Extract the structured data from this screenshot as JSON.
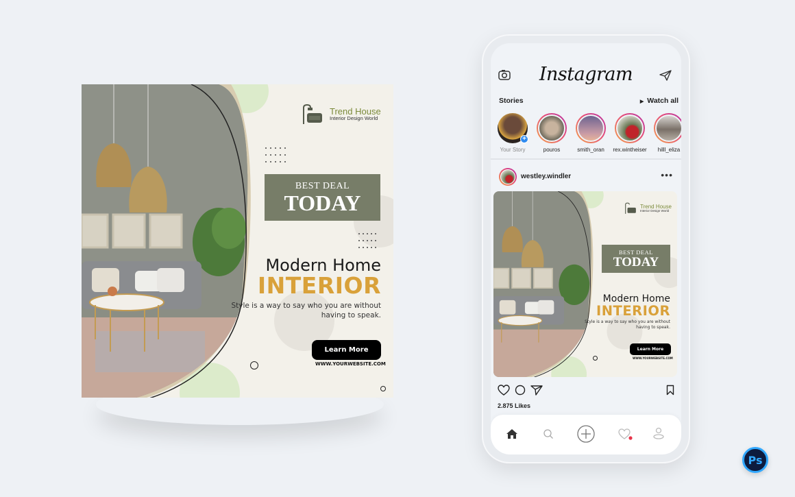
{
  "ad": {
    "brand_name": "Trend House",
    "brand_tagline": "Interior Design World",
    "deal_small": "BEST DEAL",
    "deal_large": "TODAY",
    "headline_line1": "Modern Home",
    "headline_line2": "INTERIOR",
    "description_line1": "Style is a way to say who you are without",
    "description_line2": "having to speak.",
    "cta_label": "Learn More",
    "website": "WWW.YOURWEBSITE.COM",
    "colors": {
      "background": "#f3f1ea",
      "deal_box": "#777d68",
      "accent": "#d9a13a",
      "brand": "#7b8a3a",
      "circle_green": "#dcebcb",
      "circle_grey": "#e6e3dc",
      "frame_tan": "#d8ccb0"
    }
  },
  "phone": {
    "app_name": "Instagram",
    "header_icons": {
      "left": "camera-icon",
      "right": "send-icon"
    },
    "stories_label": "Stories",
    "watch_all_label": "Watch all",
    "stories": [
      {
        "name": "Your Story",
        "own": true
      },
      {
        "name": "pouros",
        "own": false
      },
      {
        "name": "smith_oran",
        "own": false
      },
      {
        "name": "rex.wintheiser",
        "own": false
      },
      {
        "name": "hilll_eliza",
        "own": false
      }
    ],
    "post": {
      "username": "westley.windler",
      "more_icon": "more-dots-icon",
      "likes": "2.875 Likes"
    },
    "actions": [
      "heart-icon",
      "comment-icon",
      "share-icon",
      "bookmark-icon"
    ],
    "nav": [
      "home-icon",
      "search-icon",
      "add-post-icon",
      "activity-heart-icon",
      "profile-icon"
    ],
    "notification_color": "#e8344a"
  },
  "badge": {
    "label": "Ps",
    "colors": {
      "bg": "#0d1b3e",
      "fg": "#31a8ff"
    }
  }
}
